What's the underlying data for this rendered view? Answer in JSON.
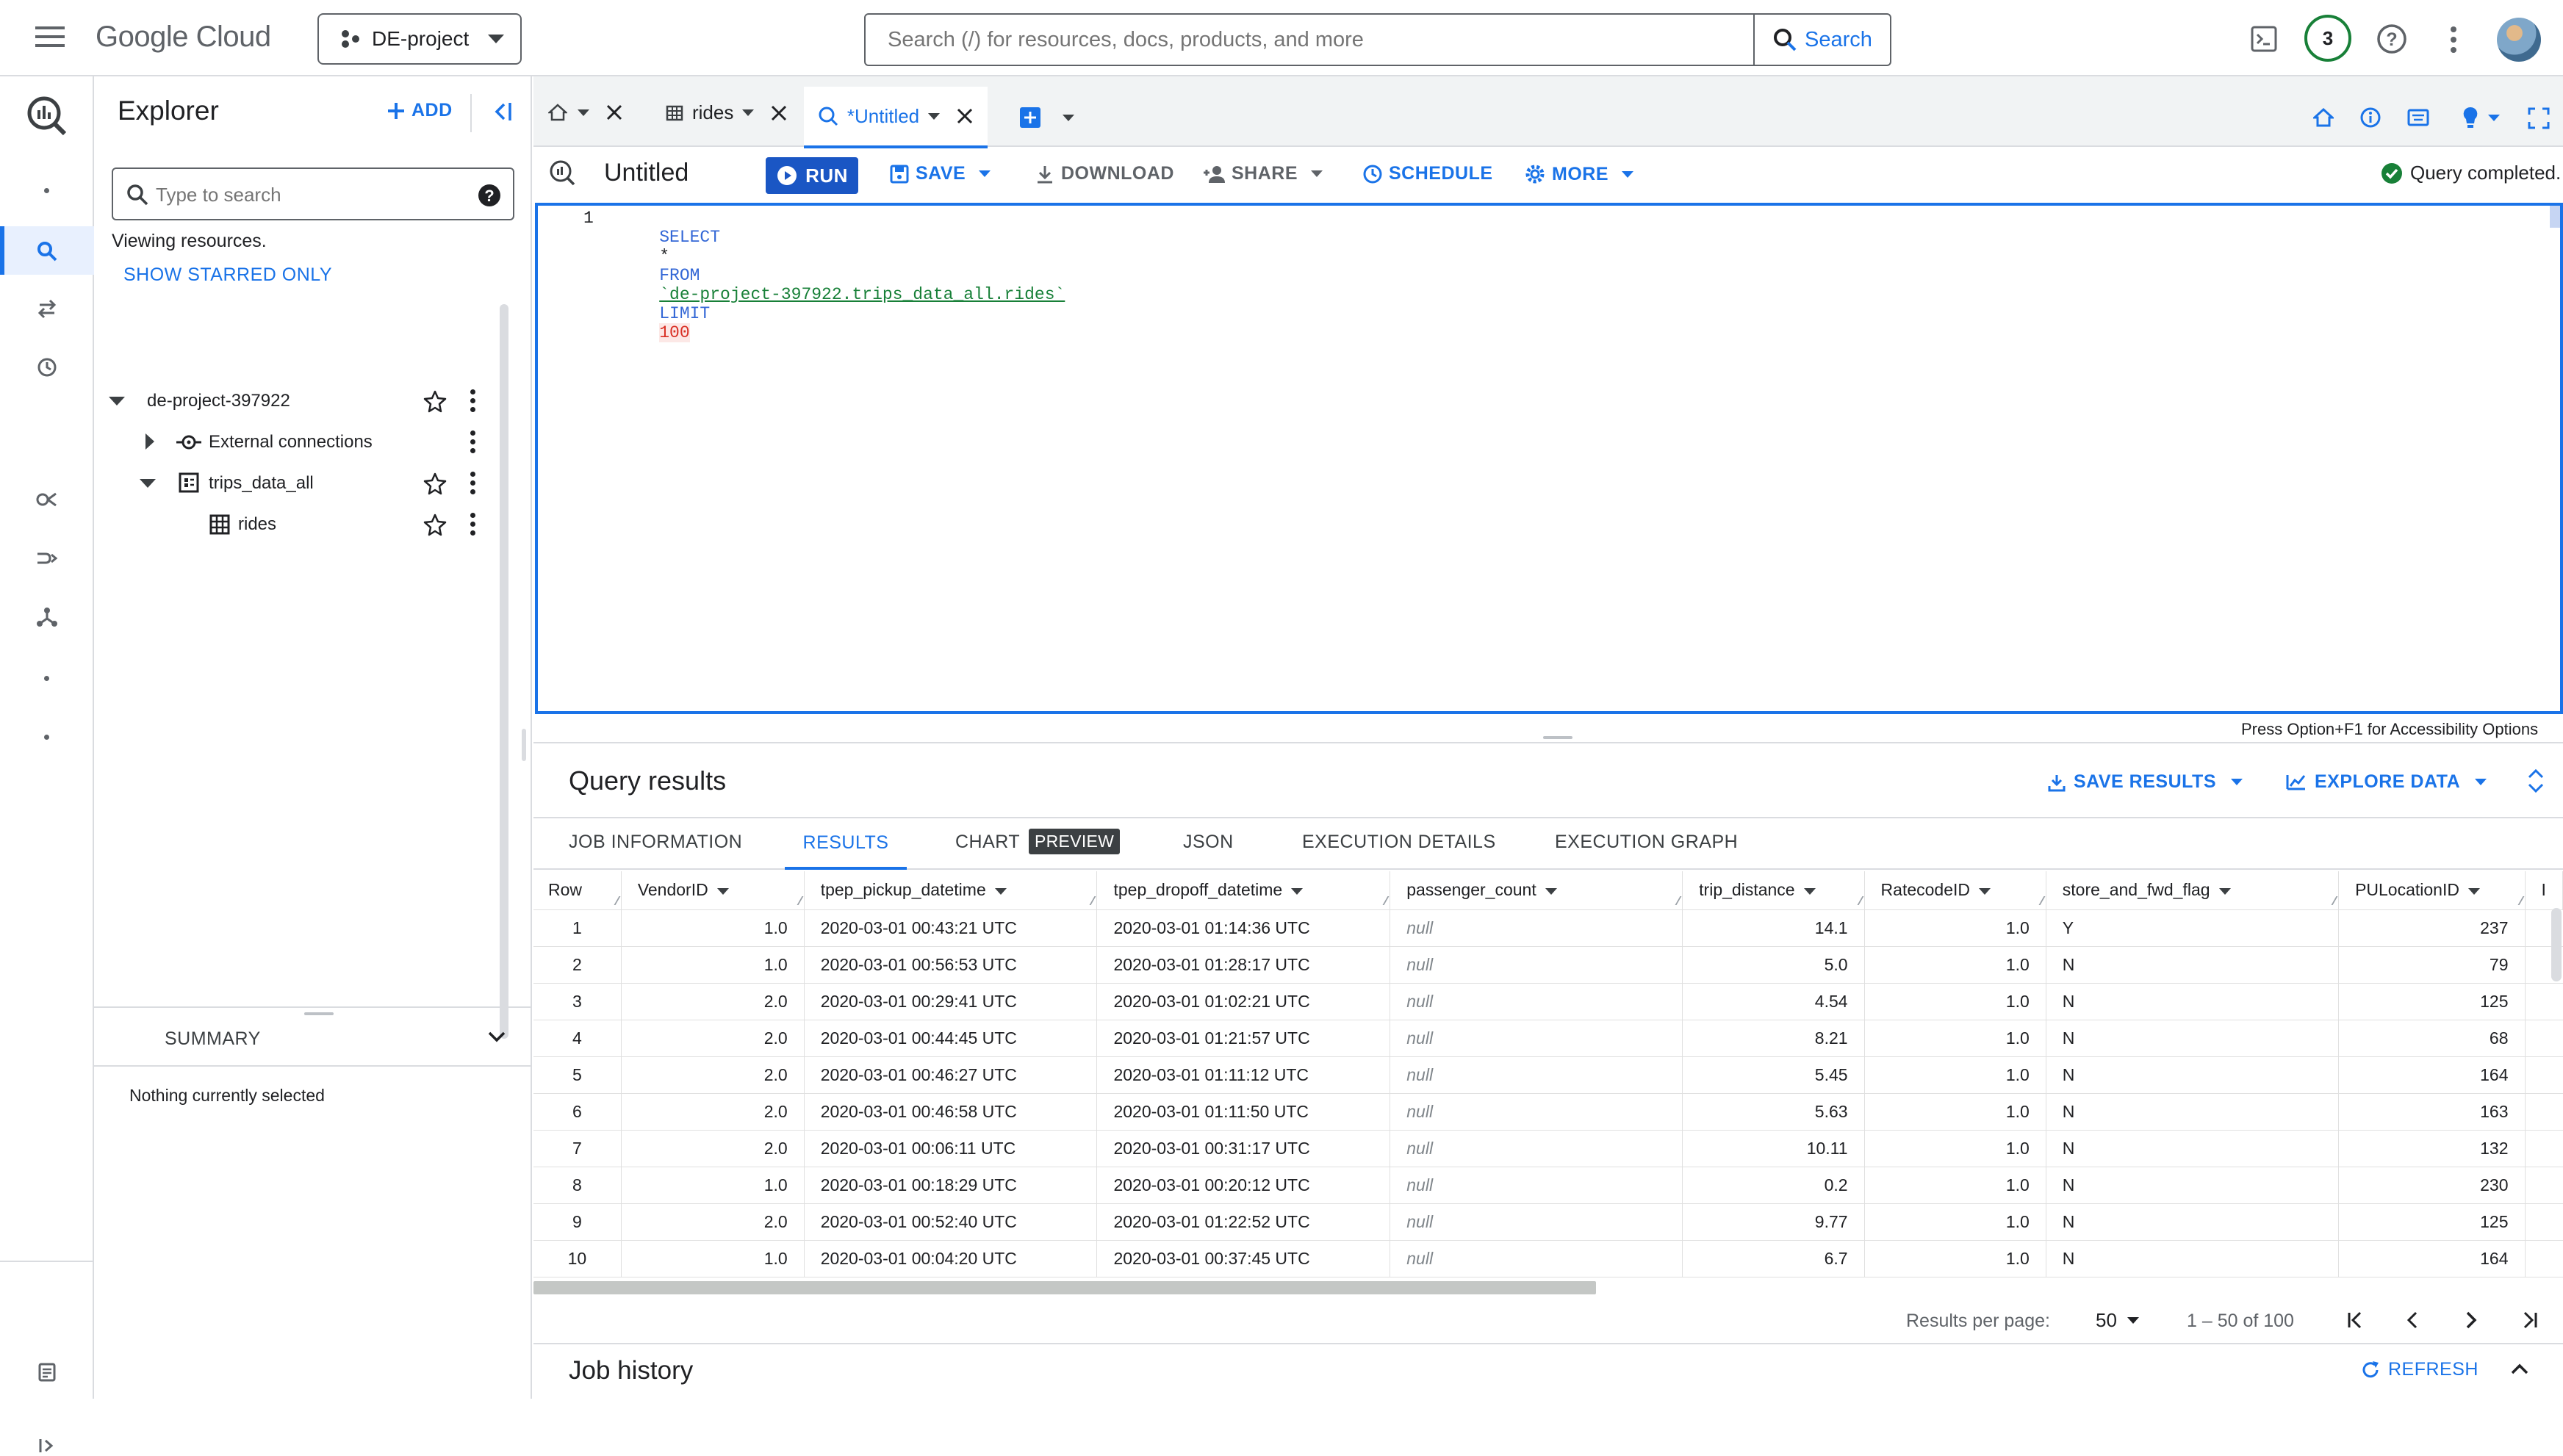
{
  "topbar": {
    "logo_text": "Google Cloud",
    "project_label": "DE-project",
    "search_placeholder": "Search (/) for resources, docs, products, and more",
    "search_button": "Search",
    "notification_count": "3"
  },
  "explorer": {
    "title": "Explorer",
    "add_label": "ADD",
    "search_placeholder": "Type to search",
    "viewing_text": "Viewing resources.",
    "starred_link": "SHOW STARRED ONLY",
    "tree": {
      "project": "de-project-397922",
      "external": "External connections",
      "dataset": "trips_data_all",
      "table": "rides"
    },
    "summary_title": "SUMMARY",
    "summary_text": "Nothing currently selected"
  },
  "tabs": {
    "rides": "rides",
    "untitled": "*Untitled"
  },
  "toolbar": {
    "title": "Untitled",
    "run": "RUN",
    "save": "SAVE",
    "download": "DOWNLOAD",
    "share": "SHARE",
    "schedule": "SCHEDULE",
    "more": "MORE",
    "status": "Query completed."
  },
  "editor": {
    "line_number": "1",
    "kw_select": "SELECT",
    "star": "*",
    "kw_from": "FROM",
    "table_ref": "`de-project-397922.trips_data_all.rides`",
    "kw_limit": "LIMIT",
    "limit_value": "100",
    "accessibility_hint": "Press Option+F1 for Accessibility Options"
  },
  "results": {
    "title": "Query results",
    "save_results": "SAVE RESULTS",
    "explore_data": "EXPLORE DATA",
    "tabs": {
      "job_info": "JOB INFORMATION",
      "results": "RESULTS",
      "chart": "CHART",
      "preview": "PREVIEW",
      "json": "JSON",
      "exec_details": "EXECUTION DETAILS",
      "exec_graph": "EXECUTION GRAPH"
    },
    "columns": [
      "Row",
      "VendorID",
      "tpep_pickup_datetime",
      "tpep_dropoff_datetime",
      "passenger_count",
      "trip_distance",
      "RatecodeID",
      "store_and_fwd_flag",
      "PULocationID",
      "I"
    ],
    "rows": [
      [
        "1",
        "1.0",
        "2020-03-01 00:43:21 UTC",
        "2020-03-01 01:14:36 UTC",
        "null",
        "14.1",
        "1.0",
        "Y",
        "237"
      ],
      [
        "2",
        "1.0",
        "2020-03-01 00:56:53 UTC",
        "2020-03-01 01:28:17 UTC",
        "null",
        "5.0",
        "1.0",
        "N",
        "79"
      ],
      [
        "3",
        "2.0",
        "2020-03-01 00:29:41 UTC",
        "2020-03-01 01:02:21 UTC",
        "null",
        "4.54",
        "1.0",
        "N",
        "125"
      ],
      [
        "4",
        "2.0",
        "2020-03-01 00:44:45 UTC",
        "2020-03-01 01:21:57 UTC",
        "null",
        "8.21",
        "1.0",
        "N",
        "68"
      ],
      [
        "5",
        "2.0",
        "2020-03-01 00:46:27 UTC",
        "2020-03-01 01:11:12 UTC",
        "null",
        "5.45",
        "1.0",
        "N",
        "164"
      ],
      [
        "6",
        "2.0",
        "2020-03-01 00:46:58 UTC",
        "2020-03-01 01:11:50 UTC",
        "null",
        "5.63",
        "1.0",
        "N",
        "163"
      ],
      [
        "7",
        "2.0",
        "2020-03-01 00:06:11 UTC",
        "2020-03-01 00:31:17 UTC",
        "null",
        "10.11",
        "1.0",
        "N",
        "132"
      ],
      [
        "8",
        "1.0",
        "2020-03-01 00:18:29 UTC",
        "2020-03-01 00:20:12 UTC",
        "null",
        "0.2",
        "1.0",
        "N",
        "230"
      ],
      [
        "9",
        "2.0",
        "2020-03-01 00:52:40 UTC",
        "2020-03-01 01:22:52 UTC",
        "null",
        "9.77",
        "1.0",
        "N",
        "125"
      ],
      [
        "10",
        "1.0",
        "2020-03-01 00:04:20 UTC",
        "2020-03-01 00:37:45 UTC",
        "null",
        "6.7",
        "1.0",
        "N",
        "164"
      ]
    ],
    "pagination": {
      "per_page_label": "Results per page:",
      "per_page_value": "50",
      "range": "1 – 50 of 100"
    }
  },
  "job_history": {
    "title": "Job history",
    "refresh": "REFRESH"
  },
  "colors": {
    "accent": "#1a73e8",
    "run_button": "#1a56c4",
    "success": "#188038",
    "border": "#dadce0"
  }
}
